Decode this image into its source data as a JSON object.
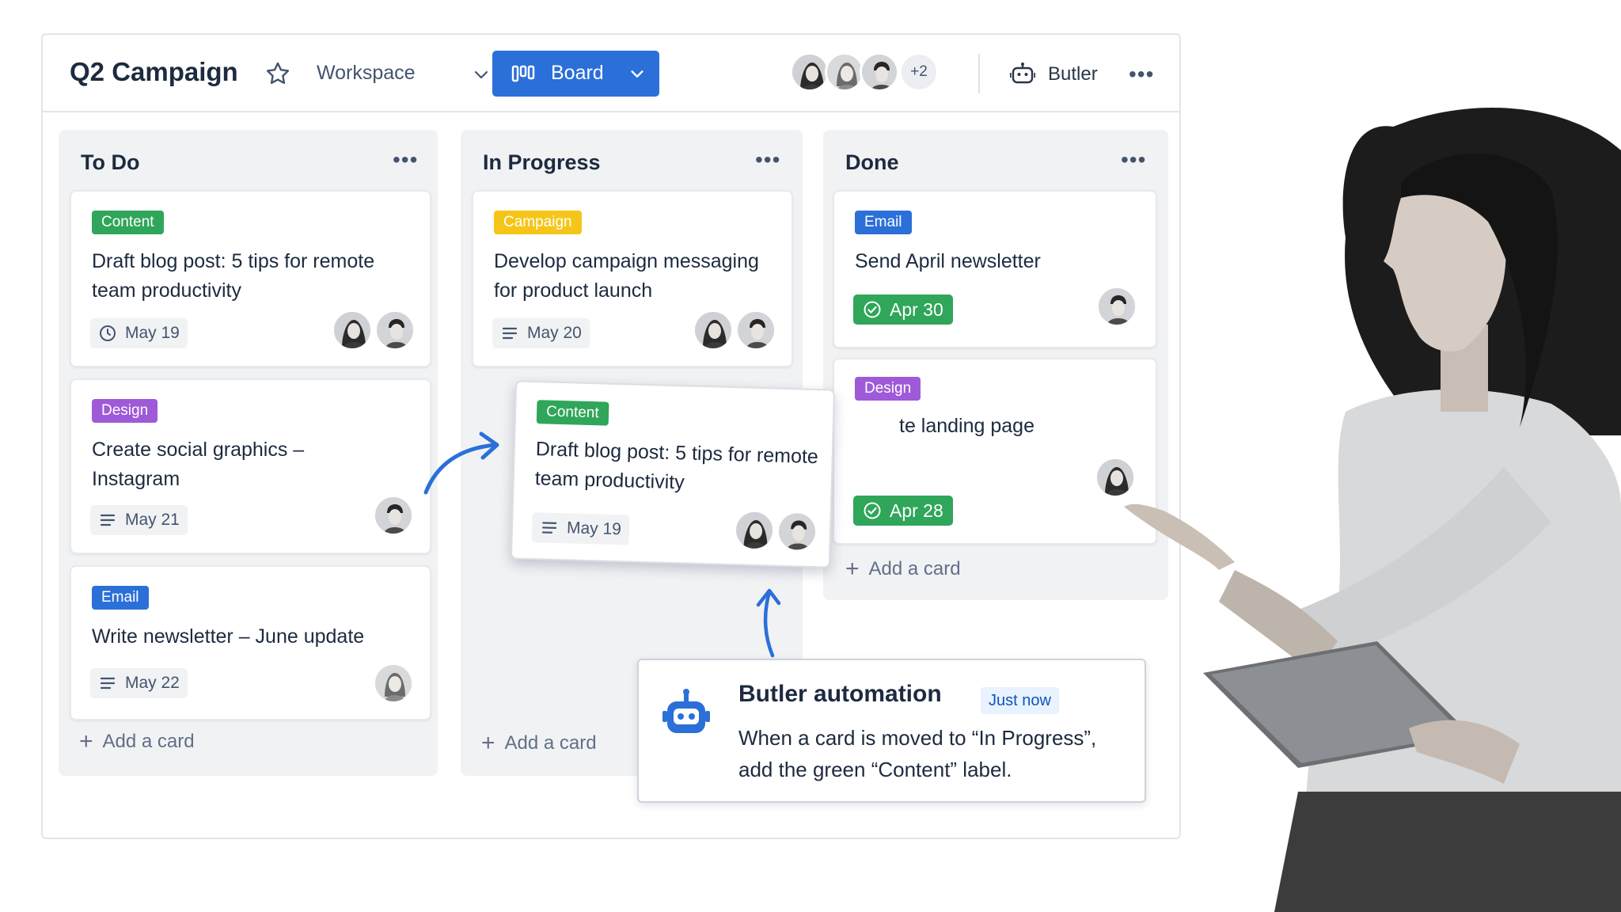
{
  "board": {
    "title": "Q2 Campaign",
    "workspace_label": "Workspace",
    "view_button_label": "Board",
    "extra_members": "+2",
    "butler_label": "Butler",
    "more": "•••"
  },
  "lists": [
    {
      "title": "To Do",
      "more": "•••",
      "add_card": "Add a card",
      "cards": [
        {
          "label": "Content",
          "label_color": "#2fa659",
          "title": "Draft blog post: 5 tips for remote team productivity",
          "date": "May 19",
          "date_icon": "clock-icon"
        },
        {
          "label": "Design",
          "label_color": "#9f5ad8",
          "title": "Create social graphics – Instagram",
          "date": "May 21",
          "date_icon": "description-icon"
        },
        {
          "label": "Email",
          "label_color": "#2b6fd9",
          "title": "Write newsletter – June update",
          "date": "May 22",
          "date_icon": "description-icon"
        }
      ]
    },
    {
      "title": "In Progress",
      "more": "•••",
      "add_card": "Add a card",
      "cards": [
        {
          "label": "Campaign",
          "label_color": "#f5c518",
          "title": "Develop campaign messaging for product launch",
          "date": "May 20",
          "date_icon": "description-icon"
        }
      ]
    },
    {
      "title": "Done",
      "more": "•••",
      "add_card": "Add a card",
      "cards": [
        {
          "label": "Email",
          "label_color": "#2b6fd9",
          "title": "Send April newsletter",
          "date": "Apr 30",
          "date_icon": "check-circle-icon"
        },
        {
          "label": "Design",
          "label_color": "#9f5ad8",
          "title": "te landing page",
          "date": "Apr 28",
          "date_icon": "check-circle-icon"
        }
      ]
    }
  ],
  "dragged_card": {
    "label": "Content",
    "label_color": "#2fa659",
    "title": "Draft blog post: 5 tips for remote team productivity",
    "date": "May 19"
  },
  "butler_popup": {
    "title": "Butler automation",
    "badge": "Just now",
    "body": "When a card is moved to “In Progress”, add the green “Content” label."
  },
  "colors": {
    "accent": "#2b6fd9",
    "done_green": "#2fa659"
  }
}
